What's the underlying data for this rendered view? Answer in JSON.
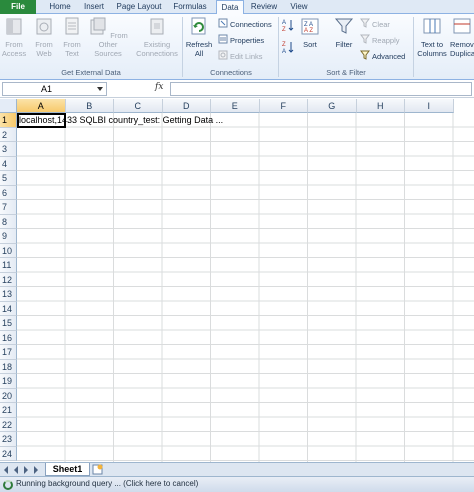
{
  "ribbon_tabs": [
    "File",
    "Home",
    "Insert",
    "Page Layout",
    "Formulas",
    "Data",
    "Review",
    "View"
  ],
  "active_tab": "Data",
  "colors": {
    "file_tab": "#2a8a3d",
    "selection": "#f7c96b",
    "ribbon_border": "#8db2e3"
  },
  "groups": {
    "get_external_data": {
      "label": "Get External Data",
      "from_access": "From Access",
      "from_web": "From Web",
      "from_text": "From Text",
      "from_other": "From Other Sources",
      "existing": "Existing Connections"
    },
    "connections": {
      "label": "Connections",
      "refresh": "Refresh All",
      "connections": "Connections",
      "properties": "Properties",
      "edit_links": "Edit Links"
    },
    "sort_filter": {
      "label": "Sort & Filter",
      "sort": "Sort",
      "filter": "Filter",
      "clear": "Clear",
      "reapply": "Reapply",
      "advanced": "Advanced"
    },
    "data_tools": {
      "text_to_columns": "Text to Columns",
      "remove_duplicates": "Remove Duplicates"
    }
  },
  "formula_bar": {
    "name_box": "A1",
    "fx_label": "fx",
    "formula": ""
  },
  "columns": [
    "A",
    "B",
    "C",
    "D",
    "E",
    "F",
    "G",
    "H",
    "I"
  ],
  "rows": [
    "1",
    "2",
    "3",
    "4",
    "5",
    "6",
    "7",
    "8",
    "9",
    "10",
    "11",
    "12",
    "13",
    "14",
    "15",
    "16",
    "17",
    "18",
    "19",
    "20",
    "21",
    "22",
    "23",
    "24"
  ],
  "cell_a1": "localhost,1433 SQLBI country_test: Getting Data ...",
  "sheet_tabs": [
    "Sheet1"
  ],
  "status_text": "Running background query ... (Click here to cancel)"
}
